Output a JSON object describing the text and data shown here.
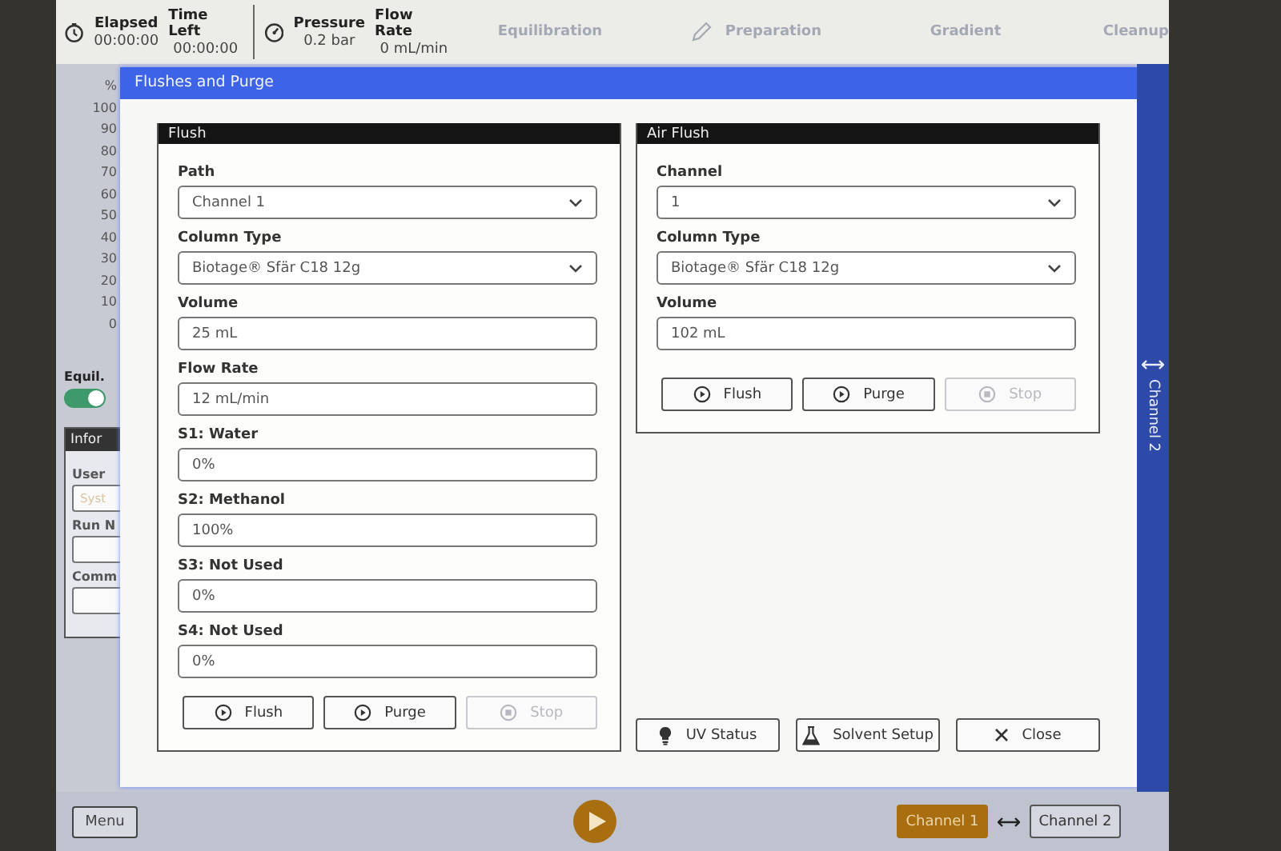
{
  "header": {
    "readouts": [
      {
        "kind": "clock",
        "items": [
          {
            "label": "Elapsed",
            "value": "00:00:00"
          },
          {
            "label": "Time Left",
            "value": "00:00:00"
          }
        ]
      },
      {
        "kind": "gauge",
        "items": [
          {
            "label": "Pressure",
            "value": "0.2 bar"
          },
          {
            "label": "Flow Rate",
            "value": "0 mL/min"
          }
        ]
      }
    ],
    "steps": [
      {
        "label": "Equilibration",
        "kind": "plain"
      },
      {
        "label": "Preparation",
        "kind": "edit"
      },
      {
        "label": "Gradient",
        "kind": "plain"
      },
      {
        "label": "Cleanup",
        "kind": "plain"
      }
    ]
  },
  "background": {
    "y_axis": {
      "unit": "%",
      "ticks": [
        "100",
        "90",
        "80",
        "70",
        "60",
        "50",
        "40",
        "30",
        "20",
        "10",
        "0"
      ]
    },
    "equil": {
      "label": "Equil.",
      "on": true
    },
    "info_panel": {
      "title": "Infor",
      "fields": [
        {
          "label": "User",
          "value": "Syst"
        },
        {
          "label": "Run N"
        },
        {
          "label": "Comm"
        }
      ]
    },
    "side_tab": {
      "label": "Channel 2"
    }
  },
  "dialog": {
    "title": "Flushes and Purge",
    "sections": [
      {
        "title": "Flush",
        "fields": [
          {
            "label": "Path",
            "kind": "select",
            "value": "Channel 1"
          },
          {
            "label": "Column Type",
            "kind": "select",
            "value": "Biotage® Sfär C18 12g"
          },
          {
            "label": "Volume",
            "kind": "text",
            "value": "25 mL"
          },
          {
            "label": "Flow Rate",
            "kind": "text",
            "value": "12 mL/min"
          },
          {
            "label": "S1: Water",
            "kind": "text",
            "value": "0%"
          },
          {
            "label": "S2: Methanol",
            "kind": "text",
            "value": "100%"
          },
          {
            "label": "S3: Not Used",
            "kind": "text",
            "value": "0%"
          },
          {
            "label": "S4: Not Used",
            "kind": "text",
            "value": "0%"
          }
        ],
        "buttons": [
          {
            "label": "Flush",
            "kind": "play",
            "disabled": false
          },
          {
            "label": "Purge",
            "kind": "play",
            "disabled": false
          },
          {
            "label": "Stop",
            "kind": "stop",
            "disabled": true
          }
        ]
      },
      {
        "title": "Air Flush",
        "fields": [
          {
            "label": "Channel",
            "kind": "select",
            "value": "1"
          },
          {
            "label": "Column Type",
            "kind": "select",
            "value": "Biotage® Sfär C18 12g"
          },
          {
            "label": "Volume",
            "kind": "text",
            "value": "102 mL"
          }
        ],
        "buttons": [
          {
            "label": "Flush",
            "kind": "play",
            "disabled": false
          },
          {
            "label": "Purge",
            "kind": "play",
            "disabled": false
          },
          {
            "label": "Stop",
            "kind": "stop",
            "disabled": true
          }
        ]
      }
    ],
    "buttons": [
      {
        "label": "UV Status",
        "kind": "bulb"
      },
      {
        "label": "Solvent Setup",
        "kind": "flask"
      },
      {
        "label": "Close",
        "kind": "close"
      }
    ]
  },
  "footer": {
    "menu": "Menu",
    "channels": [
      {
        "label": "Channel 1",
        "selected": true
      },
      {
        "label": "Channel 2",
        "selected": false
      }
    ]
  }
}
